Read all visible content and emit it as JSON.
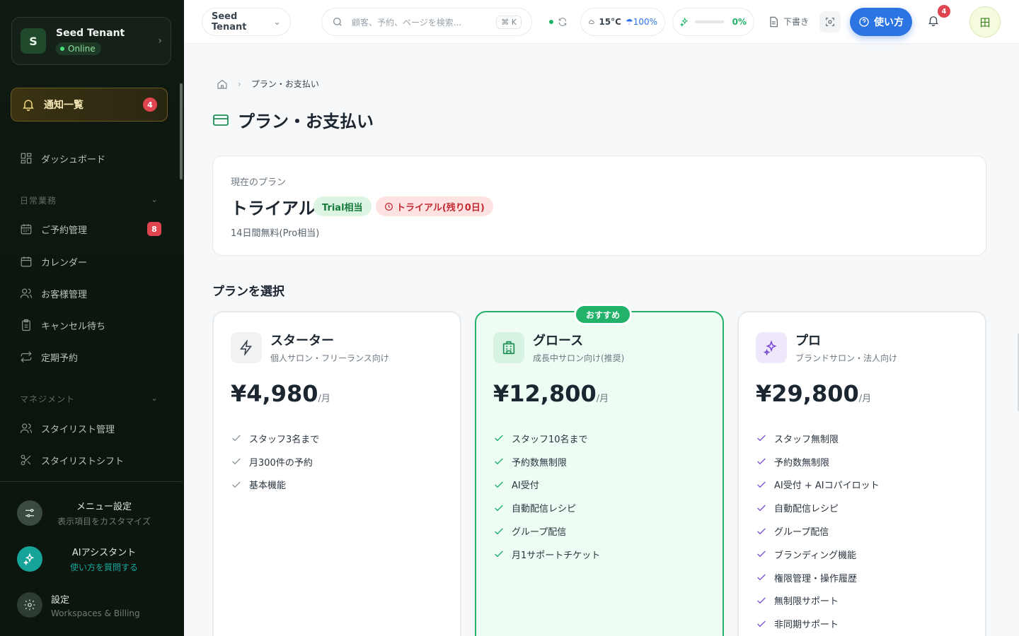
{
  "sidebar": {
    "tenant": {
      "initial": "S",
      "name": "Seed Tenant",
      "status": "Online"
    },
    "notifications": {
      "label": "通知一覧",
      "count": "4"
    },
    "dashboard": "ダッシュボード",
    "section_daily": "日常業務",
    "daily_items": [
      {
        "label": "ご予約管理",
        "icon": "calendar-grid-icon",
        "badge": "8"
      },
      {
        "label": "カレンダー",
        "icon": "calendar-icon"
      },
      {
        "label": "お客様管理",
        "icon": "users-icon"
      },
      {
        "label": "キャンセル待ち",
        "icon": "clipboard-icon"
      },
      {
        "label": "定期予約",
        "icon": "repeat-icon"
      }
    ],
    "section_management": "マネジメント",
    "management_items": [
      {
        "label": "スタイリスト管理",
        "icon": "users-icon"
      },
      {
        "label": "スタイリストシフト",
        "icon": "scissors-icon"
      }
    ],
    "menu_settings": {
      "title": "メニュー設定",
      "subtitle": "表示項目をカスタマイズ"
    },
    "ai_assistant": {
      "title": "AIアシスタント",
      "subtitle": "使い方を質問する"
    },
    "settings": {
      "title": "設定",
      "subtitle": "Workspaces & Billing"
    }
  },
  "topbar": {
    "tenant_select": "Seed Tenant",
    "search_placeholder": "顧客、予約、ページを検索...",
    "shortcut": "⌘ K",
    "weather": "15°C",
    "rain": "100%",
    "progress_value": 0,
    "progress_label": "0%",
    "draft": "下書き",
    "help": "使い方",
    "bell_count": "4",
    "profile_glyph": "田"
  },
  "page": {
    "breadcrumb": "プラン・お支払い",
    "title": "プラン・お支払い"
  },
  "current_plan": {
    "label": "現在のプラン",
    "name": "トライアル",
    "tier_chip": "Trial相当",
    "remaining_chip": "トライアル(残り0日)",
    "description": "14日間無料(Pro相当)"
  },
  "plans_section_title": "プランを選択",
  "plans": [
    {
      "name": "スターター",
      "subtitle": "個人サロン・フリーランス向け",
      "price": "¥4,980",
      "unit": "/月",
      "features": [
        "スタッフ3名まで",
        "月300件の予約",
        "基本機能"
      ]
    },
    {
      "name": "グロース",
      "subtitle": "成長中サロン向け(推奨)",
      "price": "¥12,800",
      "unit": "/月",
      "badge": "おすすめ",
      "features": [
        "スタッフ10名まで",
        "予約数無制限",
        "AI受付",
        "自動配信レシピ",
        "グループ配信",
        "月1サポートチケット"
      ]
    },
    {
      "name": "プロ",
      "subtitle": "ブランドサロン・法人向け",
      "price": "¥29,800",
      "unit": "/月",
      "features": [
        "スタッフ無制限",
        "予約数無制限",
        "AI受付 + AIコパイロット",
        "自動配信レシピ",
        "グループ配信",
        "ブランディング機能",
        "権限管理・操作履歴",
        "無制限サポート",
        "非同期サポート"
      ]
    }
  ],
  "colors": {
    "accent_green": "#22b26a",
    "help_blue": "#2b74e2",
    "badge_red": "#e0444e",
    "pro_purple": "#7b4fd6"
  }
}
